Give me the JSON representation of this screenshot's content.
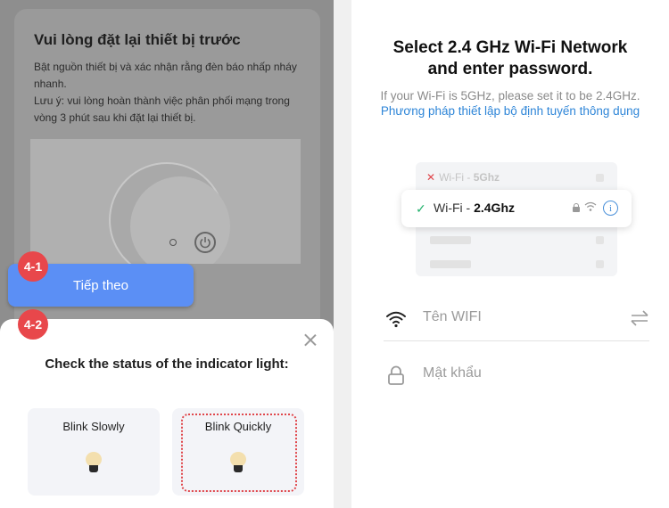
{
  "left_panel": {
    "card": {
      "title": "Vui lòng đặt lại thiết bị trước",
      "line1": "Bật nguồn thiết bị và xác nhận rằng đèn báo nhấp nháy nhanh.",
      "line2": "Lưu ý: vui lòng hoàn thành việc phân phối mạng trong vòng 3 phút sau khi đặt lại thiết bị."
    },
    "next_button_label": "Tiếp theo",
    "badges": [
      "4-1",
      "4-2"
    ],
    "sheet": {
      "title": "Check the status of the indicator light:",
      "options": [
        {
          "label": "Blink Slowly",
          "icon": "lightbulb-icon"
        },
        {
          "label": "Blink Quickly",
          "icon": "lightbulb-icon",
          "highlighted": true
        }
      ],
      "close_icon": "close-icon"
    }
  },
  "right_panel": {
    "title_line1": "Select 2.4 GHz Wi-Fi Network",
    "title_line2": "and enter password.",
    "subtitle": "If your Wi-Fi is 5GHz, please set it to be 2.4GHz.",
    "subtitle_link": "Phương pháp thiết lập bộ định tuyến thông dụng",
    "illustration": {
      "bad_network_prefix": "Wi-Fi - ",
      "bad_network_band": "5Ghz",
      "good_network_prefix": "Wi-Fi - ",
      "good_network_band": "2.4Ghz"
    },
    "wifi_field": {
      "value": "Tên WIFI",
      "icon": "wifi-icon",
      "action_icon": "swap-icon"
    },
    "password_field": {
      "placeholder": "Mật khẩu",
      "icon": "lock-icon"
    }
  },
  "colors": {
    "primary_button": "#5b8ff5",
    "badge": "#e8474b",
    "link": "#2f86d8",
    "check": "#25b36e",
    "highlight_border": "#e0464b"
  }
}
